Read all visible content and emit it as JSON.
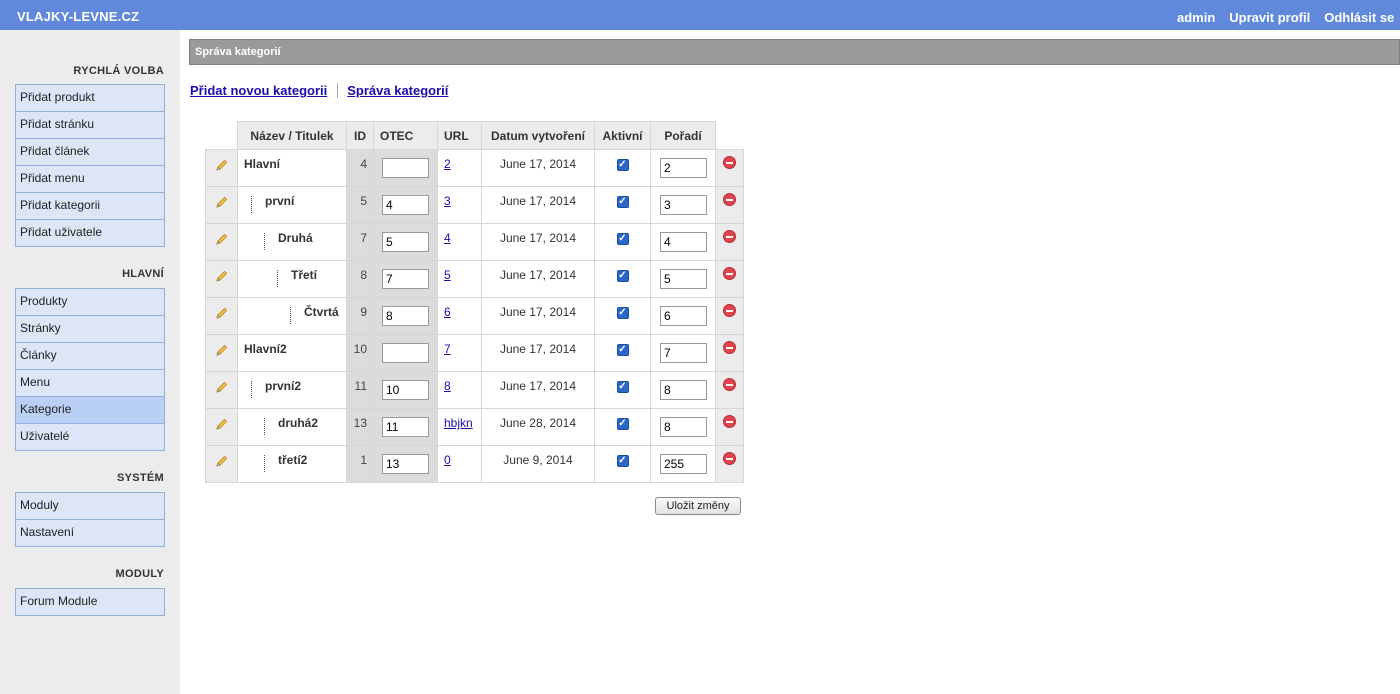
{
  "topbar": {
    "brand": "VLAJKY-LEVNE.CZ",
    "nav": [
      "admin",
      "Upravit profil",
      "Odhlásit se"
    ]
  },
  "sidebar": {
    "sections": [
      {
        "title": "RYCHLÁ VOLBA",
        "items": [
          "Přidat produkt",
          "Přidat stránku",
          "Přidat článek",
          "Přidat menu",
          "Přidat kategorii",
          "Přidat uživatele"
        ]
      },
      {
        "title": "HLAVNÍ",
        "items": [
          "Produkty",
          "Stránky",
          "Články",
          "Menu",
          "Kategorie",
          "Uživatelé"
        ],
        "active": "Kategorie"
      },
      {
        "title": "SYSTÉM",
        "items": [
          "Moduly",
          "Nastavení"
        ]
      },
      {
        "title": "MODULY",
        "items": [
          "Forum Module"
        ]
      }
    ]
  },
  "main": {
    "header": "Správa kategorií",
    "links": [
      "Přidat novou kategorii",
      "Správa kategorií"
    ],
    "table": {
      "columns": [
        "Název / Titulek",
        "ID",
        "OTEC",
        "URL",
        "Datum vytvoření",
        "Aktivní",
        "Pořadí"
      ],
      "rows": [
        {
          "name": "Hlavní",
          "level": 0,
          "id": "4",
          "otec": "",
          "url": "2",
          "date": "June 17, 2014",
          "active": true,
          "order": "2"
        },
        {
          "name": "první",
          "level": 1,
          "id": "5",
          "otec": "4",
          "url": "3",
          "date": "June 17, 2014",
          "active": true,
          "order": "3"
        },
        {
          "name": "Druhá",
          "level": 2,
          "id": "7",
          "otec": "5",
          "url": "4",
          "date": "June 17, 2014",
          "active": true,
          "order": "4"
        },
        {
          "name": "Třetí",
          "level": 3,
          "id": "8",
          "otec": "7",
          "url": "5",
          "date": "June 17, 2014",
          "active": true,
          "order": "5"
        },
        {
          "name": "Čtvrtá",
          "level": 4,
          "id": "9",
          "otec": "8",
          "url": "6",
          "date": "June 17, 2014",
          "active": true,
          "order": "6"
        },
        {
          "name": "Hlavní2",
          "level": 0,
          "id": "10",
          "otec": "",
          "url": "7",
          "date": "June 17, 2014",
          "active": true,
          "order": "7"
        },
        {
          "name": "první2",
          "level": 1,
          "id": "11",
          "otec": "10",
          "url": "8",
          "date": "June 17, 2014",
          "active": true,
          "order": "8"
        },
        {
          "name": "druhá2",
          "level": 2,
          "id": "13",
          "otec": "11",
          "url": "hbjkn",
          "date": "June 28, 2014",
          "active": true,
          "order": "8"
        },
        {
          "name": "třetí2",
          "level": 2,
          "id": "1",
          "otec": "13",
          "url": "0",
          "date": "June 9, 2014",
          "active": true,
          "order": "255"
        }
      ]
    },
    "save_label": "Uložit změny"
  },
  "colors": {
    "topbar": "#6189db",
    "sidebar_bg": "#ececec",
    "menu_item": "#dce6f7",
    "menu_active": "#b9cff3",
    "header_bar": "#9a9a9a",
    "link": "#1a0dab"
  }
}
